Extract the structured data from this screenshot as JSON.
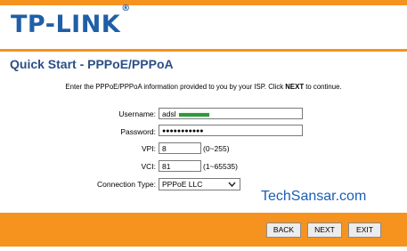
{
  "brand": {
    "name": "TP-LINK",
    "trademark": "®"
  },
  "page": {
    "title": "Quick Start - PPPoE/PPPoA"
  },
  "instructions": {
    "before": "Enter the PPPoE/PPPoA information provided to you by your ISP. Click ",
    "emphasis": "NEXT",
    "after": " to continue."
  },
  "form": {
    "username": {
      "label": "Username:",
      "value": "adsl"
    },
    "password": {
      "label": "Password:",
      "value": "●●●●●●●●●●●"
    },
    "vpi": {
      "label": "VPI:",
      "value": "8",
      "hint": "(0~255)"
    },
    "vci": {
      "label": "VCI:",
      "value": "81",
      "hint": "(1~65535)"
    },
    "connection_type": {
      "label": "Connection Type:",
      "value": "PPPoE LLC"
    }
  },
  "watermark": "TechSansar.com",
  "buttons": {
    "back": "BACK",
    "next": "NEXT",
    "exit": "EXIT"
  },
  "colors": {
    "accent": "#f6921e",
    "brand": "#1f5fa7",
    "title": "#2b4f86"
  },
  "icons": {
    "select_arrow": "chevron-down-icon"
  }
}
